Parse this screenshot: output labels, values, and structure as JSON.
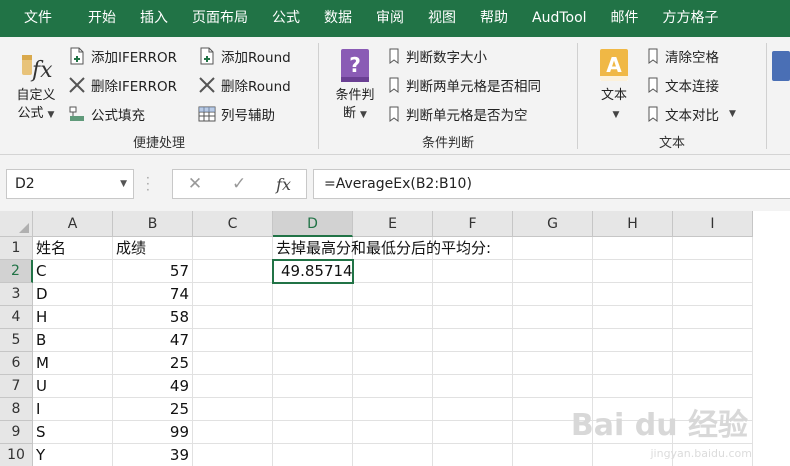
{
  "menu": {
    "tabs": [
      "文件",
      "开始",
      "插入",
      "页面布局",
      "公式",
      "数据",
      "审阅",
      "视图",
      "帮助",
      "AudTool",
      "邮件",
      "方方格子"
    ]
  },
  "ribbon": {
    "group1": {
      "label": "便捷处理",
      "big_button": {
        "line1": "自定义",
        "line2": "公式"
      },
      "add_iferror": "添加IFERROR",
      "del_iferror": "删除IFERROR",
      "formula_fill": "公式填充",
      "add_round": "添加Round",
      "del_round": "删除Round",
      "col_helper": "列号辅助"
    },
    "group2": {
      "label": "条件判断",
      "big_button": {
        "line1": "条件判",
        "line2": "断"
      },
      "judge_num_size": "判断数字大小",
      "judge_two_same": "判断两单元格是否相同",
      "judge_empty": "判断单元格是否为空"
    },
    "group3": {
      "label": "文本",
      "big_button": {
        "line1": "文本"
      },
      "clear_spaces": "清除空格",
      "text_concat": "文本连接",
      "text_compare": "文本对比"
    }
  },
  "formula_bar": {
    "name_box": "D2",
    "fx_label": "fx",
    "formula": "=AverageEx(B2:B10)"
  },
  "sheet": {
    "columns": [
      "A",
      "B",
      "C",
      "D",
      "E",
      "F",
      "G",
      "H",
      "I"
    ],
    "rows": [
      "1",
      "2",
      "3",
      "4",
      "5",
      "6",
      "7",
      "8",
      "9",
      "10"
    ],
    "header_a": "姓名",
    "header_b": "成绩",
    "note_d1": "去掉最高分和最低分后的平均分:",
    "result_d2": "49.85714",
    "names": [
      "C",
      "D",
      "H",
      "B",
      "M",
      "U",
      "I",
      "S",
      "Y"
    ],
    "scores": [
      "57",
      "74",
      "58",
      "47",
      "25",
      "49",
      "25",
      "99",
      "39"
    ]
  },
  "watermark": {
    "text": "Bai du 经验",
    "sub": "jingyan.baidu.com"
  },
  "colors": {
    "accent": "#217346",
    "ribbon_bg": "#f3f3f3",
    "header_bg": "#e6e6e6"
  }
}
